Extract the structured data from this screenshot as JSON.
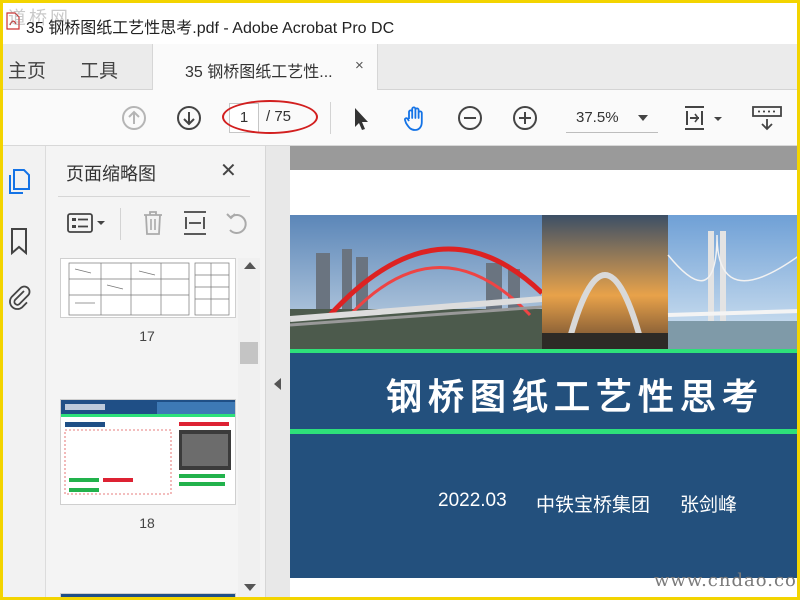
{
  "window": {
    "title": "35 钢桥图纸工艺性思考.pdf - Adobe Acrobat Pro DC",
    "watermark": "道桥网"
  },
  "tabs": {
    "home": "主页",
    "tools": "工具",
    "document": "35  钢桥图纸工艺性...",
    "close": "×"
  },
  "toolbar": {
    "current_page": "1",
    "total_pages": "/ 75",
    "zoom": "37.5%"
  },
  "panel": {
    "title": "页面缩略图",
    "close": "✕",
    "thumbnails": [
      {
        "page": "17"
      },
      {
        "page": "18"
      }
    ]
  },
  "document": {
    "title": "钢桥图纸工艺性思考",
    "date": "2022.03",
    "company": "中铁宝桥集团",
    "author": "张剑峰"
  },
  "footer": {
    "watermark": "www.cndao.com"
  },
  "colors": {
    "accent": "#1473e6",
    "band": "#23507d",
    "green_rule": "#2ee07a",
    "annotation": "#d21f1f"
  }
}
